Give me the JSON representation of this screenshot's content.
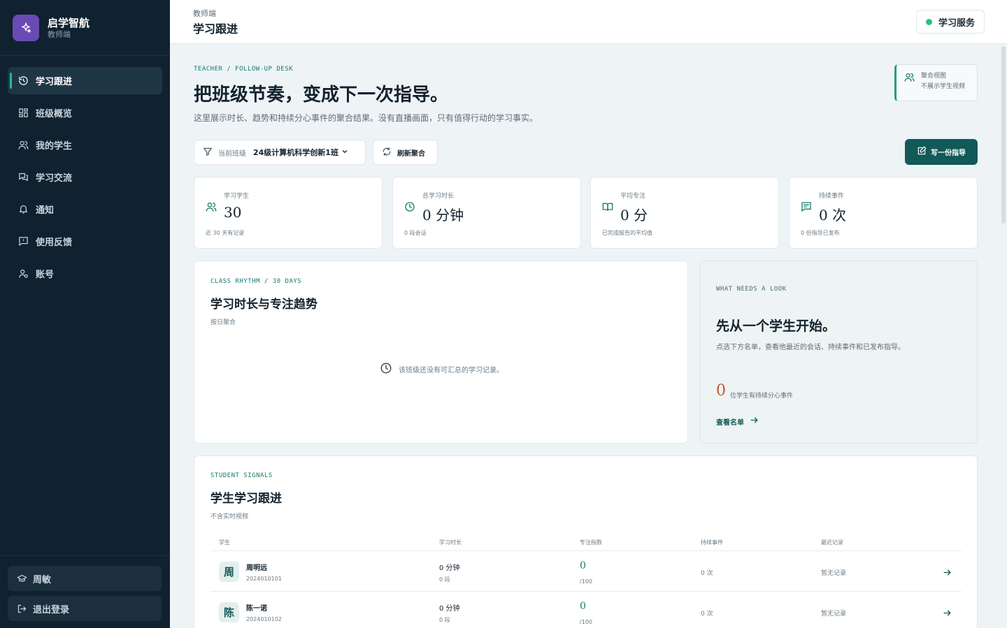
{
  "sidebar": {
    "brand_name": "启学智航",
    "brand_sub": "教师端",
    "items": [
      {
        "label": "学习跟进",
        "icon": "refresh-clock-icon",
        "active": true
      },
      {
        "label": "班级概览",
        "icon": "grid-icon"
      },
      {
        "label": "我的学生",
        "icon": "users-icon"
      },
      {
        "label": "学习交流",
        "icon": "chat-icon"
      },
      {
        "label": "通知",
        "icon": "bell-icon"
      },
      {
        "label": "使用反馈",
        "icon": "feedback-icon"
      },
      {
        "label": "账号",
        "icon": "user-gear-icon"
      }
    ],
    "user_label": "周敏",
    "logout_label": "退出登录"
  },
  "topbar": {
    "crumb": "教师端",
    "title": "学习跟进",
    "service_label": "学习服务",
    "service_status_color": "#22c283"
  },
  "hero": {
    "eyebrow": "TEACHER / FOLLOW-UP DESK",
    "title": "把班级节奏，变成下一次指导。",
    "desc": "这里展示时长、趋势和持续分心事件的聚合结果。没有直播画面，只有值得行动的学习事实。",
    "agg_line1": "聚合视图",
    "agg_line2": "不展示学生视频"
  },
  "toolbar": {
    "class_label": "当前班级",
    "class_value": "24级计算机科学创新1班",
    "refresh_label": "刷新聚合",
    "write_label": "写一份指导"
  },
  "stats": [
    {
      "label": "学习学生",
      "value": "30",
      "foot": "近 30 天有记录",
      "icon": "users-icon"
    },
    {
      "label": "总学习时长",
      "value": "0 分钟",
      "foot": "0 段会话",
      "icon": "clock-icon"
    },
    {
      "label": "平均专注",
      "value": "0 分",
      "foot": "已完成报告的平均值",
      "icon": "book-icon"
    },
    {
      "label": "持续事件",
      "value": "0 次",
      "foot": "0 份指导已发布",
      "icon": "message-icon"
    }
  ],
  "trend": {
    "eyebrow": "CLASS RHYTHM / 30 DAYS",
    "title": "学习时长与专注趋势",
    "sub": "按日聚合",
    "empty_text": "该班级还没有可汇总的学习记录。"
  },
  "look": {
    "eyebrow": "WHAT NEEDS A LOOK",
    "title": "先从一个学生开始。",
    "desc": "点选下方名单，查看他最近的会话、持续事件和已发布指导。",
    "count": "0",
    "count_text": "位学生有持续分心事件",
    "link_label": "查看名单"
  },
  "signals": {
    "eyebrow": "STUDENT SIGNALS",
    "title": "学生学习跟进",
    "sub": "不含实时视频",
    "headers": {
      "student": "学生",
      "time": "学习时长",
      "focus": "专注指数",
      "events": "持续事件",
      "recent": "最近记录"
    },
    "rows": [
      {
        "avatar": "周",
        "name": "周明远",
        "id": "2024010101",
        "time": "0 分钟",
        "segments": "0 段",
        "focus": "0",
        "focus_den": "/100",
        "events": "0 次",
        "recent": "暂无记录"
      },
      {
        "avatar": "陈",
        "name": "陈一诺",
        "id": "2024010102",
        "time": "0 分钟",
        "segments": "0 段",
        "focus": "0",
        "focus_den": "/100",
        "events": "0 次",
        "recent": "暂无记录"
      }
    ]
  }
}
